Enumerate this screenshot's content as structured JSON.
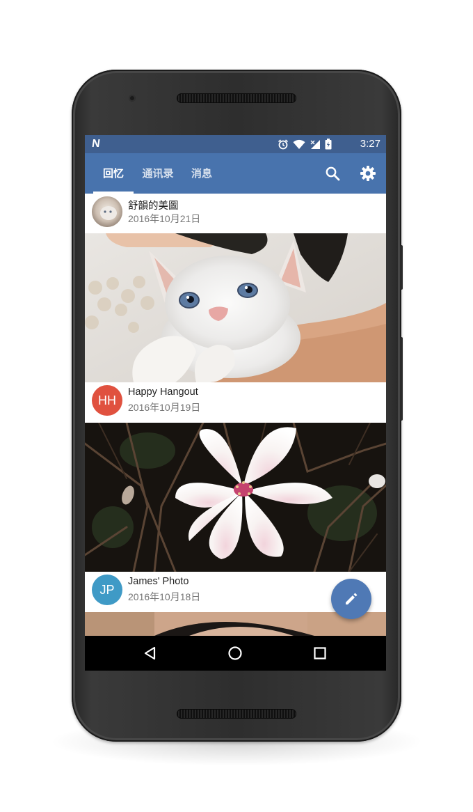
{
  "status_bar": {
    "left_icon": "n-notification-icon",
    "icons": [
      "alarm-icon",
      "wifi-icon",
      "signal-icon",
      "battery-icon"
    ],
    "time": "3:27",
    "color": "#3f5f8f"
  },
  "toolbar": {
    "color": "#4873ad",
    "tabs": [
      {
        "label": "回忆",
        "active": true
      },
      {
        "label": "通讯录",
        "active": false
      },
      {
        "label": "消息",
        "active": false
      }
    ],
    "actions": [
      "search-icon",
      "gear-icon"
    ]
  },
  "feed": {
    "items": [
      {
        "title": "舒韻的美圖",
        "date": "2016年10月21日",
        "avatar_type": "photo",
        "photo": "kitten-photo"
      },
      {
        "title": "Happy Hangout",
        "date": "2016年10月19日",
        "avatar_initials": "HH",
        "avatar_color": "#e0513f",
        "photo": "magnolia-photo"
      },
      {
        "title": "James' Photo",
        "date": "2016年10月18日",
        "avatar_initials": "JP",
        "avatar_color": "#3f9ac6",
        "photo": "face-photo"
      }
    ]
  },
  "fab": {
    "icon": "pencil-icon",
    "color": "#4f79b5"
  },
  "nav_bar": {
    "buttons": [
      "back-icon",
      "home-icon",
      "recents-icon"
    ]
  }
}
